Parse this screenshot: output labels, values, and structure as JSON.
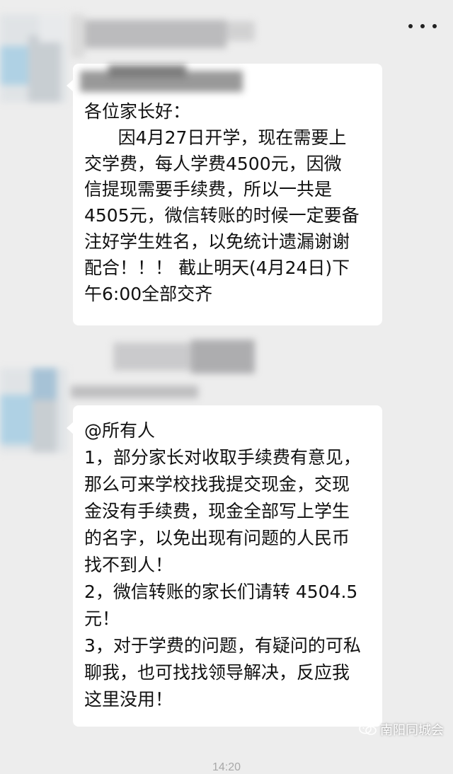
{
  "message1": {
    "lines": [
      "各位家长好：",
      "      因4月27日开学，现在需要上",
      "交学费，每人学费4500元，因微",
      "信提现需要手续费，所以一共是",
      "4505元，微信转账的时候一定要备",
      "注好学生姓名，以免统计遗漏谢谢",
      "配合！！！ 截止明天(4月24日)下",
      "午6:00全部交齐"
    ]
  },
  "message2": {
    "lines": [
      "@所有人",
      "1，部分家长对收取手续费有意见，",
      "那么可来学校找我提交现金，交现",
      "金没有手续费，现金全部写上学生",
      "的名字，以免出现有问题的人民币",
      "找不到人！",
      "2，微信转账的家长们请转 4504.5",
      "元！",
      "3，对于学费的问题，有疑问的可私",
      "聊我，也可找找领导解决，反应我",
      "这里没用！"
    ]
  },
  "watermark": {
    "text": "南阳同城会",
    "icon": "wechat-icon"
  },
  "timestamp": "14:20",
  "icons": {
    "more": "more-icon"
  },
  "colors": {
    "background": "#ededed",
    "bubble": "#ffffff",
    "text": "#111111"
  }
}
